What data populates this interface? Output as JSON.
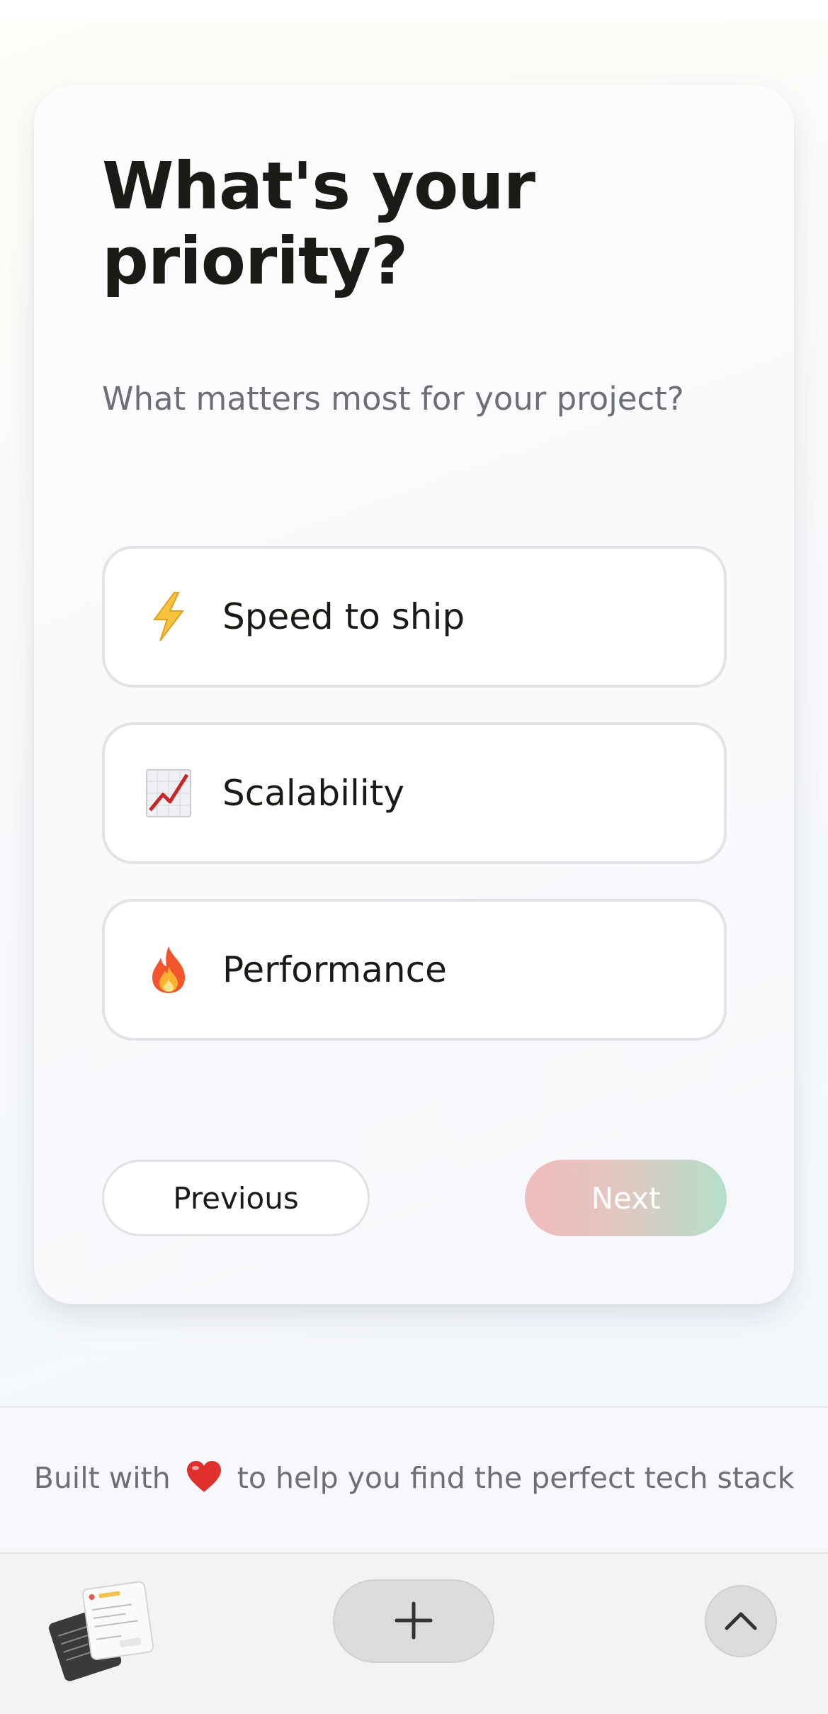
{
  "quiz": {
    "title": "What's your priority?",
    "subtitle": "What matters most for your project?",
    "options": [
      {
        "icon": "lightning-icon",
        "label": "Speed to ship"
      },
      {
        "icon": "chart-increasing-icon",
        "label": "Scalability"
      },
      {
        "icon": "fire-icon",
        "label": "Performance"
      }
    ],
    "nav": {
      "previous_label": "Previous",
      "next_label": "Next"
    }
  },
  "footer": {
    "text_before": "Built with",
    "heart_icon": "heart-icon",
    "text_after": "to help you find the perfect tech stack"
  },
  "browser_bar": {
    "tabs_icon": "tabs-thumbnail-icon",
    "new_tab_icon": "plus-icon",
    "scroll_up_icon": "chevron-up-icon"
  },
  "colors": {
    "title": "#1c1a17",
    "subtitle": "#6d6f77",
    "next_gradient_start": "#efbdbd",
    "next_gradient_end": "#b4dfca",
    "option_border": "#e2e3e6"
  }
}
